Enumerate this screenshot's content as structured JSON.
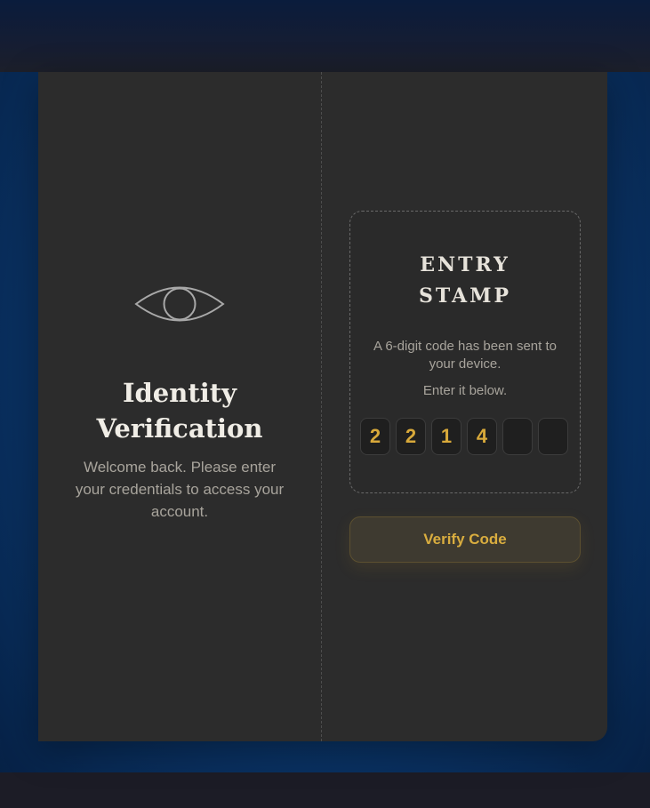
{
  "left": {
    "icon": "eye-icon",
    "title": "Identity Verification",
    "subtitle": "Welcome back. Please enter your credentials to access your account."
  },
  "stamp": {
    "title_line1": "ENTRY",
    "title_line2": "STAMP",
    "message": "A 6-digit code has been sent to your device.",
    "hint": "Enter it below.",
    "code": [
      "2",
      "2",
      "1",
      "4",
      "",
      ""
    ]
  },
  "verify_button": {
    "label": "Verify Code"
  },
  "colors": {
    "accent": "#d9ad3f",
    "card_bg": "#2c2c2c",
    "page_bg": "#0b3a72"
  }
}
